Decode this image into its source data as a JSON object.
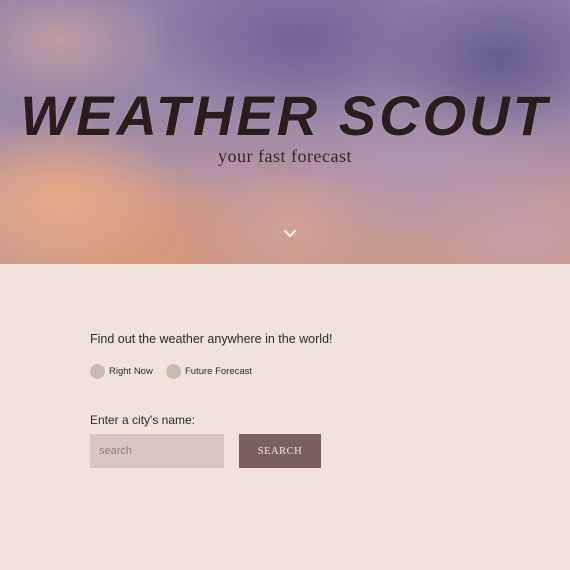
{
  "hero": {
    "title": "WEATHER SCOUT",
    "subtitle": "your fast forecast",
    "scroll_icon": "chevron-down-icon"
  },
  "main": {
    "intro": "Find out the weather anywhere in the world!",
    "modes": [
      {
        "label": "Right Now",
        "selected": false
      },
      {
        "label": "Future Forecast",
        "selected": false
      }
    ],
    "city_label": "Enter a city's name:",
    "search": {
      "placeholder": "search",
      "value": "",
      "button_label": "SEARCH"
    }
  },
  "colors": {
    "page_background": "#efe3dc",
    "title_text": "#2a1e1c",
    "radio_fill": "#cdb9b2",
    "input_background": "#d8c7c0",
    "button_background": "#7a5f5c",
    "button_text": "#f2e8e4"
  }
}
